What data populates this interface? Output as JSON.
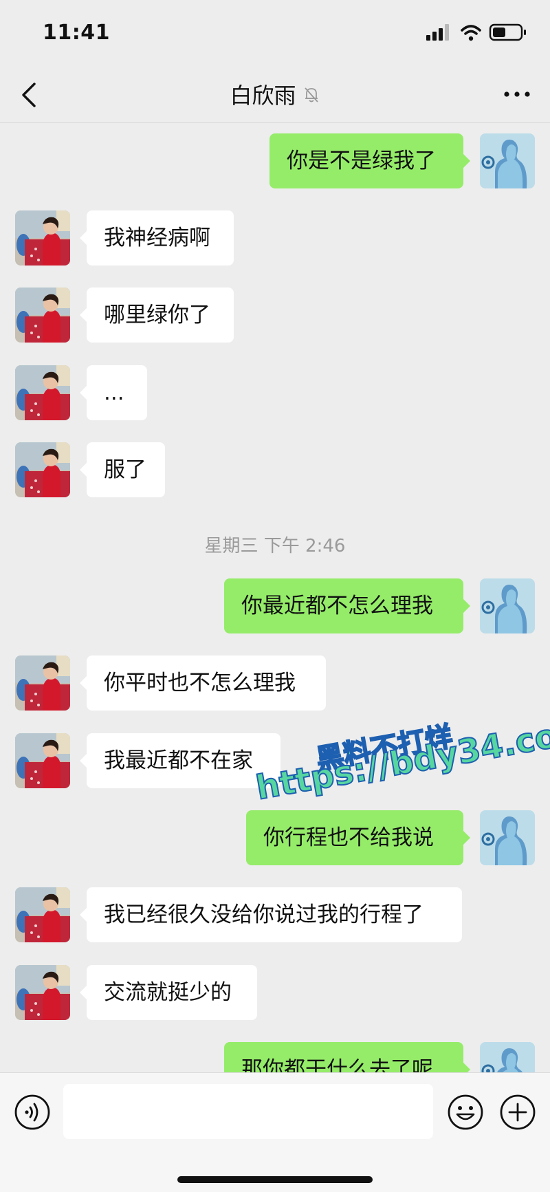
{
  "status_bar": {
    "time": "11:41",
    "icons": [
      "signal-icon",
      "wifi-icon",
      "battery-icon"
    ]
  },
  "header": {
    "title": "白欣雨",
    "icons": [
      "back-chevron-icon",
      "mute-bell-icon",
      "more-dots-icon"
    ]
  },
  "messages": [
    {
      "side": "out",
      "text": "你是不是绿我了"
    },
    {
      "side": "in",
      "text": "我神经病啊"
    },
    {
      "side": "in",
      "text": "哪里绿你了"
    },
    {
      "side": "in",
      "text": "..."
    },
    {
      "side": "in",
      "text": "服了"
    },
    {
      "side": "out",
      "text": "你最近都不怎么理我"
    },
    {
      "side": "in",
      "text": "你平时也不怎么理我"
    },
    {
      "side": "in",
      "text": "我最近都不在家"
    },
    {
      "side": "out",
      "text": "你行程也不给我说"
    },
    {
      "side": "in",
      "text": "我已经很久没给你说过我的行程了"
    },
    {
      "side": "in",
      "text": "交流就挺少的"
    },
    {
      "side": "out",
      "text": "那你都干什么去了呢"
    }
  ],
  "timestamp": "星期三 下午 2:46",
  "watermark": {
    "line1": "黑料不打烊",
    "line2": "https://bdy34.co"
  },
  "input_bar": {
    "placeholder": "",
    "icons": [
      "voice-icon",
      "emoji-icon",
      "plus-icon"
    ]
  },
  "colors": {
    "background": "#ededed",
    "outgoing_bubble": "#95ec69",
    "incoming_bubble": "#ffffff",
    "timestamp_text": "#9a9a9a"
  }
}
